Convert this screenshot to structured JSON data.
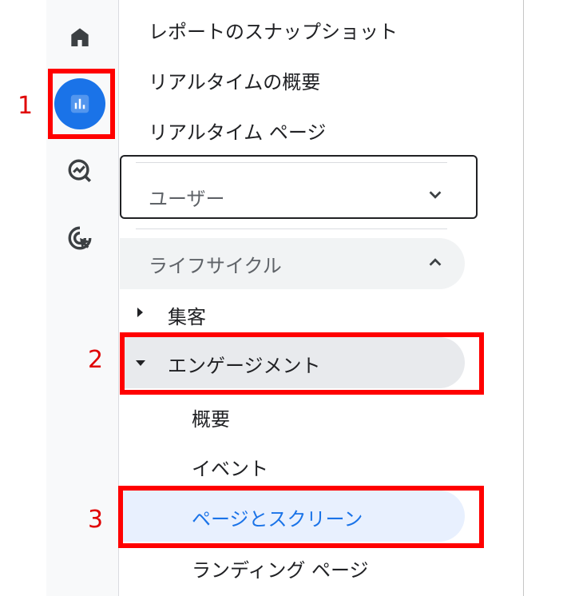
{
  "nav": {
    "home_icon": "home-icon",
    "reports_icon": "bar-chart-icon",
    "explore_icon": "explore-chart-icon",
    "advertising_icon": "cursor-target-icon"
  },
  "menu": {
    "snapshot": "レポートのスナップショット",
    "realtime_overview": "リアルタイムの概要",
    "realtime_pages": "リアルタイム ページ",
    "user_section": "ユーザー",
    "lifecycle_section": "ライフサイクル",
    "acquisition": "集客",
    "engagement": "エンゲージメント",
    "engagement_overview": "概要",
    "events": "イベント",
    "pages_screens": "ページとスクリーン",
    "landing_page": "ランディング ページ"
  },
  "steps": {
    "one": "1",
    "two": "2",
    "three": "3"
  },
  "colors": {
    "accent": "#1a73e8",
    "callout": "#ff0000",
    "selected_bg": "#e8f0fe",
    "hover_bg": "#e8eaed"
  }
}
